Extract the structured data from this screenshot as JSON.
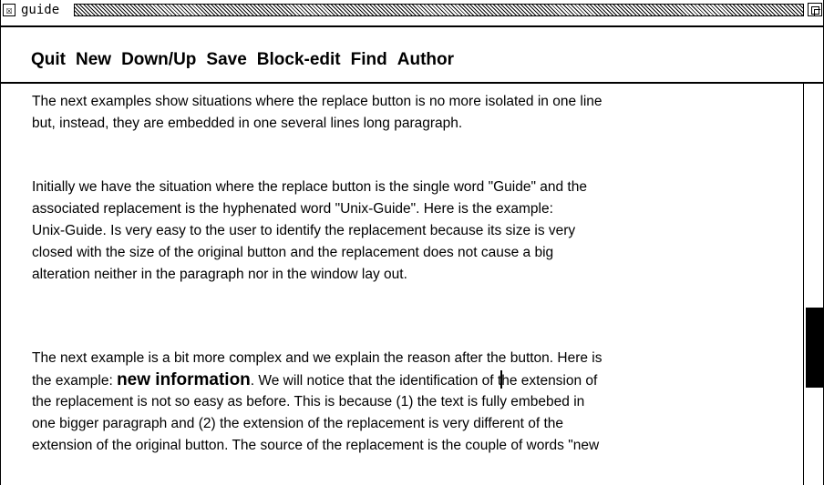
{
  "window": {
    "title": "guide",
    "close_glyph": "☒"
  },
  "menu": {
    "items": [
      "Quit",
      "New",
      "Down/Up",
      "Save",
      "Block-edit",
      "Find",
      "Author"
    ]
  },
  "content": {
    "paragraph1": [
      "The next examples show situations where the replace button is no more isolated in one line",
      "but, instead, they are embedded in one several lines long paragraph."
    ],
    "paragraph2": [
      "Initially we have the situation where the replace button is the single word \"Guide\" and the",
      "associated replacement is the hyphenated word \"Unix-Guide\". Here is the example:",
      "Unix-Guide. Is very easy to the user to identify the replacement because its size is very",
      "closed with the size of the original button and the replacement does not cause a big",
      "alteration neither  in the paragraph  nor in the window lay out."
    ],
    "paragraph3": {
      "line1": "The next example is a bit more complex and we explain the reason after the button. Here is",
      "line2_before": "the example: ",
      "line2_link": "new information",
      "line2_mid": ". We will notice that the identification of t",
      "line2_after": "he extension of",
      "line3": "the replacement is not so easy as before. This is because (1) the text is fully embebed in",
      "line4": "one bigger paragraph and (2) the extension of the replacement is very different of the",
      "line5": "extension of the original button.   The source of the replacement is the couple of words \"new"
    }
  },
  "scrollbar": {
    "position_fraction": 0.56,
    "thumb_color": "#000000"
  },
  "colors": {
    "background": "#ffffff",
    "foreground": "#000000"
  }
}
